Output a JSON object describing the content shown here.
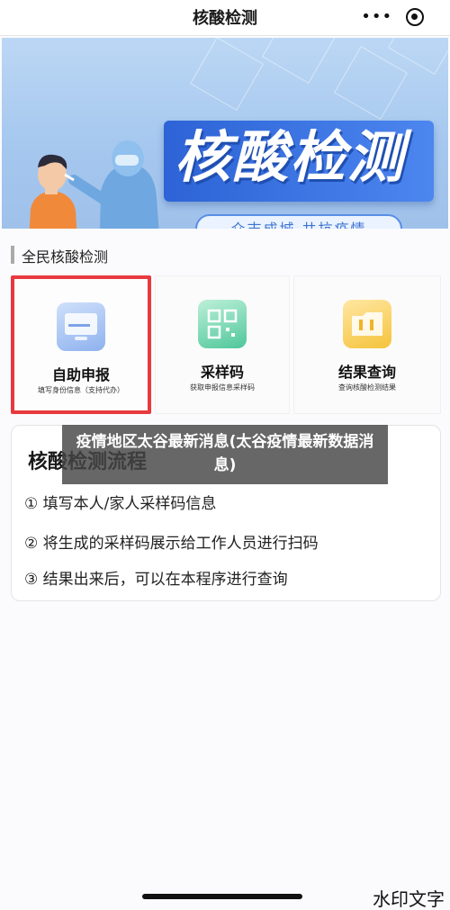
{
  "navbar": {
    "title": "核酸检测",
    "more_icon": "more-dots-icon",
    "close_icon": "target-close-icon"
  },
  "banner": {
    "title": "核酸检测",
    "slogan": "众志成城  共抗疫情",
    "colors": {
      "sky": "#a6c8ef",
      "plate": "#2d63d6",
      "text": "#ffffff"
    }
  },
  "section": {
    "title": "全民核酸检测"
  },
  "cards": [
    {
      "label": "自助申报",
      "sub": "填写身份信息（支持代办）",
      "icon": "monitor-icon",
      "selected": true
    },
    {
      "label": "采样码",
      "sub": "获取申报信息采样码",
      "icon": "qrcode-icon",
      "selected": false
    },
    {
      "label": "结果查询",
      "sub": "查询核酸检测结果",
      "icon": "folder-icon",
      "selected": false
    }
  ],
  "process": {
    "title": "核酸检测流程",
    "steps": [
      "① 填写本人/家人采样码信息",
      "② 将生成的采样码展示给工作人员进行扫码",
      "③ 结果出来后，可以在本程序进行查询"
    ]
  },
  "overlay": {
    "text": "疫情地区太谷最新消息(太谷疫情最新数据消息)"
  },
  "watermark": "水印文字",
  "accent_colors": {
    "highlight_border": "#e8393f",
    "nav_bg": "#ffffff"
  }
}
